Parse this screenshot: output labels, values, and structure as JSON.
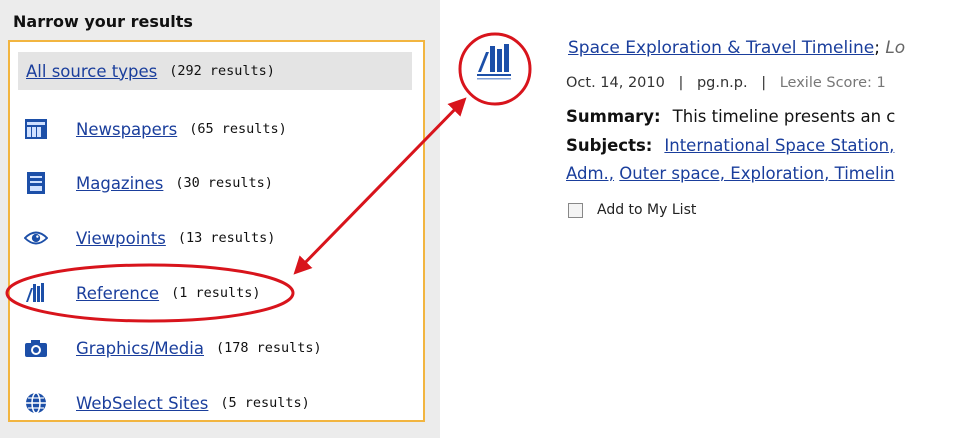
{
  "left_panel": {
    "heading": "Narrow your results",
    "facets": [
      {
        "label": "All source types",
        "count": "(292 results)",
        "icon": "none"
      },
      {
        "label": "Newspapers",
        "count": "(65 results)",
        "icon": "newspaper-icon"
      },
      {
        "label": "Magazines",
        "count": "(30 results)",
        "icon": "magazine-icon"
      },
      {
        "label": "Viewpoints",
        "count": "(13 results)",
        "icon": "eye-icon"
      },
      {
        "label": "Reference",
        "count": "(1 results)",
        "icon": "reference-books-icon"
      },
      {
        "label": "Graphics/Media",
        "count": "(178 results)",
        "icon": "camera-icon"
      },
      {
        "label": "WebSelect Sites",
        "count": "(5 results)",
        "icon": "globe-icon"
      }
    ]
  },
  "result": {
    "title": "Space Exploration & Travel Timeline",
    "title_sep": ";",
    "title_trail": "Lo",
    "date": "Oct. 14, 2010",
    "page": "pg.n.p.",
    "lexile": "Lexile Score: 1",
    "summary_label": "Summary:",
    "summary_text": "This timeline presents an c",
    "subjects_label": "Subjects:",
    "subject_1": "International Space Station,",
    "subject_2": "Adm.,",
    "subject_3": "Outer space, Exploration, Timelin",
    "add_to_list": "Add to My List"
  },
  "colors": {
    "link": "#1a3e9c",
    "box_border": "#f2b540",
    "annotation": "#d8141c",
    "icon_blue": "#1c4fa8"
  }
}
